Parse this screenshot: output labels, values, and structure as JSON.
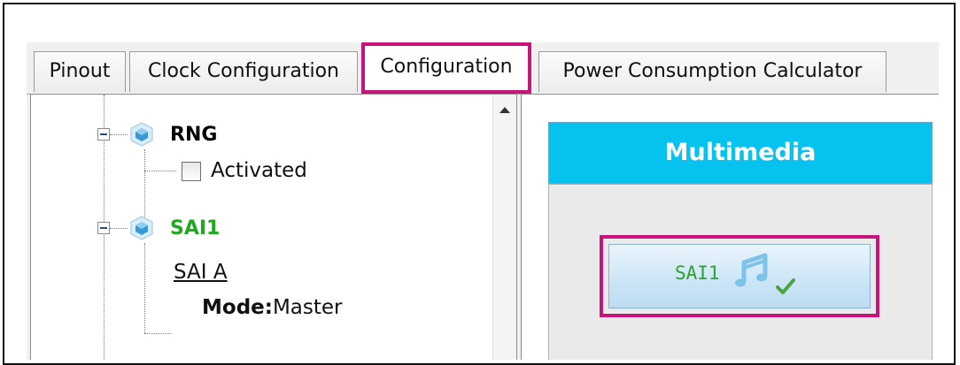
{
  "tabs": [
    {
      "label": "Pinout",
      "active": false
    },
    {
      "label": "Clock Configuration",
      "active": false
    },
    {
      "label": "Configuration",
      "active": true
    },
    {
      "label": "Power Consumption Calculator",
      "active": false
    }
  ],
  "tree": {
    "rng": {
      "title": "RNG",
      "checkbox_label": "Activated",
      "checked": false
    },
    "sai1": {
      "title": "SAI1",
      "title_color": "#1fa91f",
      "sub_item": "SAI A",
      "mode_key": "Mode:",
      "mode_value": "Master"
    }
  },
  "right_panel": {
    "category_title": "Multimedia",
    "header_color": "#06c2ee",
    "button_label": "SAI1",
    "button_label_color": "#2da12d",
    "button_icon": "music-note-icon",
    "status_icon": "checkmark-icon",
    "highlight_color": "#c8147a"
  }
}
